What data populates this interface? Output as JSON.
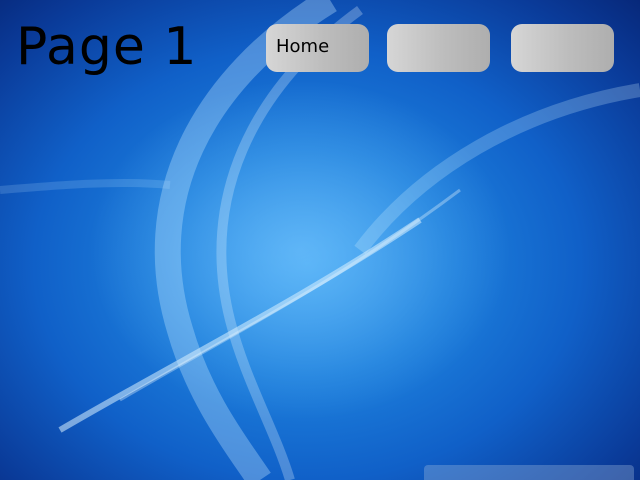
{
  "page": {
    "title": "Page 1"
  },
  "nav": {
    "buttons": [
      {
        "label": "Home"
      },
      {
        "label": ""
      },
      {
        "label": ""
      }
    ]
  },
  "wallpaper": {
    "status_text": "",
    "colors": {
      "base": "#1060c8",
      "highlight": "#3ea3f0",
      "edge": "#07287a"
    }
  }
}
